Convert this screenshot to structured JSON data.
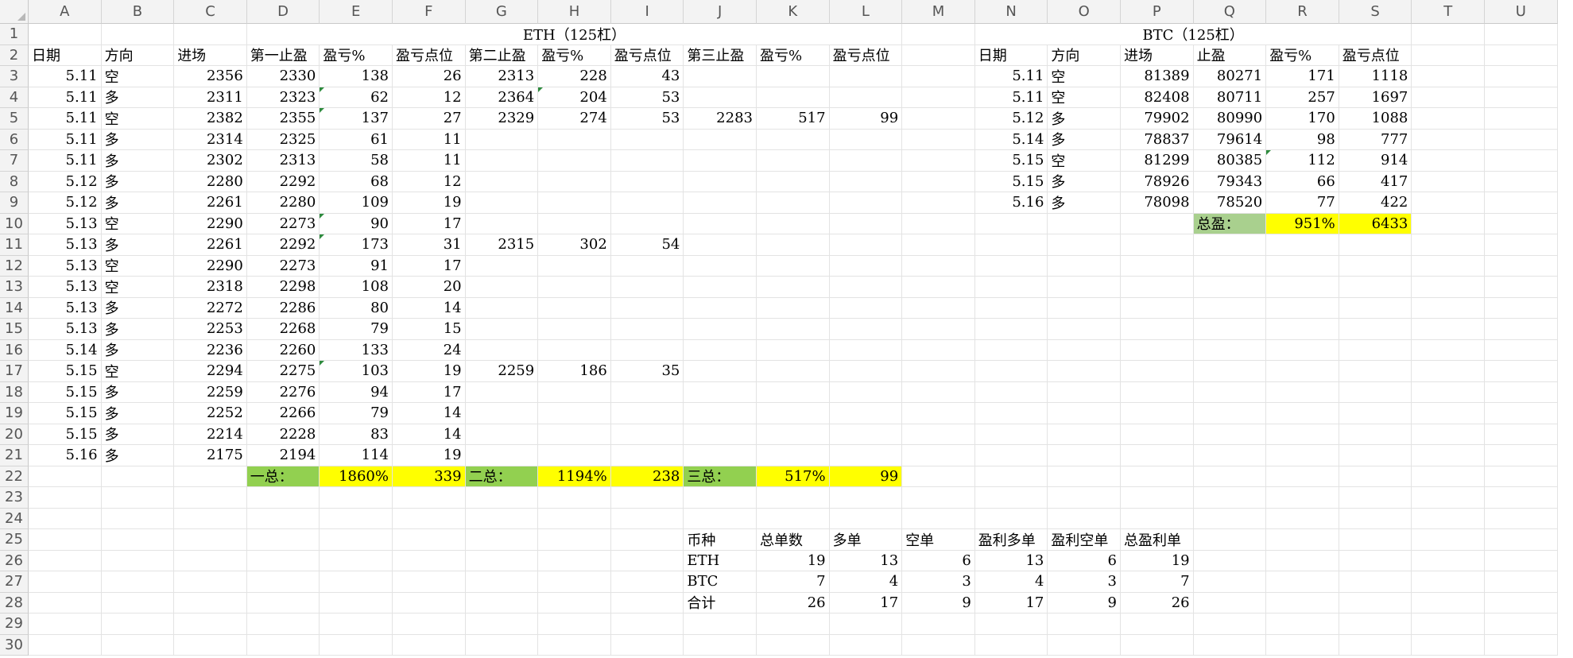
{
  "columns": [
    "A",
    "B",
    "C",
    "D",
    "E",
    "F",
    "G",
    "H",
    "I",
    "J",
    "K",
    "L",
    "M",
    "N",
    "O",
    "P",
    "Q",
    "R",
    "S",
    "T",
    "U"
  ],
  "colors": {
    "yellow": "#ffff00",
    "green": "#92d050",
    "light_green": "#a9d08e",
    "header_bg": "#f3f3f3",
    "gridline": "#e3e3e3",
    "error_indicator": "#2e8b3e"
  },
  "cells": {
    "D1": "ETH（125杠）",
    "Q1": "BTC（125杠）",
    "A2": "日期",
    "B2": "方向",
    "C2": "进场",
    "D2": "第一止盈",
    "E2": "盈亏%",
    "F2": "盈亏点位",
    "G2": "第二止盈",
    "H2": "盈亏%",
    "I2": "盈亏点位",
    "J2": "第三止盈",
    "K2": "盈亏%",
    "L2": "盈亏点位",
    "N2": "日期",
    "O2": "方向",
    "P2": "进场",
    "Q2": "止盈",
    "R2": "盈亏%",
    "S2": "盈亏点位",
    "A3": "5.11",
    "B3": "空",
    "C3": "2356",
    "D3": "2330",
    "E3": "138",
    "F3": "26",
    "G3": "2313",
    "H3": "228",
    "I3": "43",
    "N3": "5.11",
    "O3": "空",
    "P3": "81389",
    "Q3": "80271",
    "R3": "171",
    "S3": "1118",
    "A4": "5.11",
    "B4": "多",
    "C4": "2311",
    "D4": "2323",
    "E4": "62",
    "F4": "12",
    "G4": "2364",
    "H4": "204",
    "I4": "53",
    "N4": "5.11",
    "O4": "空",
    "P4": "82408",
    "Q4": "80711",
    "R4": "257",
    "S4": "1697",
    "A5": "5.11",
    "B5": "空",
    "C5": "2382",
    "D5": "2355",
    "E5": "137",
    "F5": "27",
    "G5": "2329",
    "H5": "274",
    "I5": "53",
    "J5": "2283",
    "K5": "517",
    "L5": "99",
    "N5": "5.12",
    "O5": "多",
    "P5": "79902",
    "Q5": "80990",
    "R5": "170",
    "S5": "1088",
    "A6": "5.11",
    "B6": "多",
    "C6": "2314",
    "D6": "2325",
    "E6": "61",
    "F6": "11",
    "N6": "5.14",
    "O6": "多",
    "P6": "78837",
    "Q6": "79614",
    "R6": "98",
    "S6": "777",
    "A7": "5.11",
    "B7": "多",
    "C7": "2302",
    "D7": "2313",
    "E7": "58",
    "F7": "11",
    "N7": "5.15",
    "O7": "空",
    "P7": "81299",
    "Q7": "80385",
    "R7": "112",
    "S7": "914",
    "A8": "5.12",
    "B8": "多",
    "C8": "2280",
    "D8": "2292",
    "E8": "68",
    "F8": "12",
    "N8": "5.15",
    "O8": "多",
    "P8": "78926",
    "Q8": "79343",
    "R8": "66",
    "S8": "417",
    "A9": "5.12",
    "B9": "多",
    "C9": "2261",
    "D9": "2280",
    "E9": "109",
    "F9": "19",
    "N9": "5.16",
    "O9": "多",
    "P9": "78098",
    "Q9": "78520",
    "R9": "77",
    "S9": "422",
    "A10": "5.13",
    "B10": "空",
    "C10": "2290",
    "D10": "2273",
    "E10": "90",
    "F10": "17",
    "Q10": "总盈：",
    "R10": "951%",
    "S10": "6433",
    "A11": "5.13",
    "B11": "多",
    "C11": "2261",
    "D11": "2292",
    "E11": "173",
    "F11": "31",
    "G11": "2315",
    "H11": "302",
    "I11": "54",
    "A12": "5.13",
    "B12": "空",
    "C12": "2290",
    "D12": "2273",
    "E12": "91",
    "F12": "17",
    "A13": "5.13",
    "B13": "空",
    "C13": "2318",
    "D13": "2298",
    "E13": "108",
    "F13": "20",
    "A14": "5.13",
    "B14": "多",
    "C14": "2272",
    "D14": "2286",
    "E14": "80",
    "F14": "14",
    "A15": "5.13",
    "B15": "多",
    "C15": "2253",
    "D15": "2268",
    "E15": "79",
    "F15": "15",
    "A16": "5.14",
    "B16": "多",
    "C16": "2236",
    "D16": "2260",
    "E16": "133",
    "F16": "24",
    "A17": "5.15",
    "B17": "空",
    "C17": "2294",
    "D17": "2275",
    "E17": "103",
    "F17": "19",
    "G17": "2259",
    "H17": "186",
    "I17": "35",
    "A18": "5.15",
    "B18": "多",
    "C18": "2259",
    "D18": "2276",
    "E18": "94",
    "F18": "17",
    "A19": "5.15",
    "B19": "多",
    "C19": "2252",
    "D19": "2266",
    "E19": "79",
    "F19": "14",
    "A20": "5.15",
    "B20": "多",
    "C20": "2214",
    "D20": "2228",
    "E20": "83",
    "F20": "14",
    "A21": "5.16",
    "B21": "多",
    "C21": "2175",
    "D21": "2194",
    "E21": "114",
    "F21": "19",
    "D22": "一总：",
    "E22": "1860%",
    "F22": "339",
    "G22": "二总：",
    "H22": "1194%",
    "I22": "238",
    "J22": "三总：",
    "K22": "517%",
    "L22": "99",
    "J25": "币种",
    "K25": "总单数",
    "L25": "多单",
    "M25": "空单",
    "N25": "盈利多单",
    "O25": "盈利空单",
    "P25": "总盈利单",
    "J26": "ETH",
    "K26": "19",
    "L26": "13",
    "M26": "6",
    "N26": "13",
    "O26": "6",
    "P26": "19",
    "J27": "BTC",
    "K27": "7",
    "L27": "4",
    "M27": "3",
    "N27": "4",
    "O27": "3",
    "P27": "7",
    "J28": "合计",
    "K28": "26",
    "L28": "17",
    "M28": "9",
    "N28": "17",
    "O28": "9",
    "P28": "26"
  },
  "fills": {
    "D22": "green",
    "E22": "yellow",
    "F22": "yellow",
    "G22": "green",
    "H22": "yellow",
    "I22": "yellow",
    "J22": "green",
    "K22": "yellow",
    "L22": "yellow",
    "Q10": "light_green",
    "R10": "yellow",
    "S10": "yellow"
  },
  "error_indicators": [
    "E4",
    "E5",
    "E10",
    "E11",
    "E17",
    "H4",
    "R7"
  ]
}
